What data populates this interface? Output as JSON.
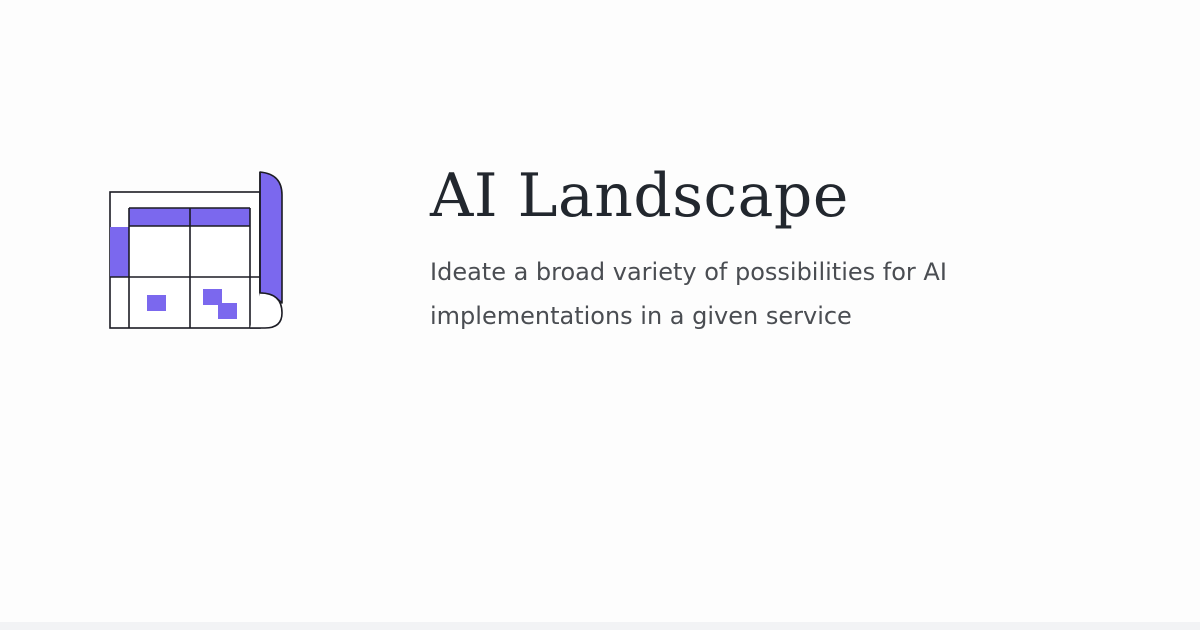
{
  "hero": {
    "title": "AI Landscape",
    "description": "Ideate a broad variety of possibilities for AI implementations in a given service",
    "icon": "landscape-blueprint-icon"
  },
  "colors": {
    "accent": "#7b68ee",
    "outline": "#1c1c24",
    "title_text": "#22272e",
    "body_text": "#4a4d52",
    "background": "#fdfdfd"
  }
}
